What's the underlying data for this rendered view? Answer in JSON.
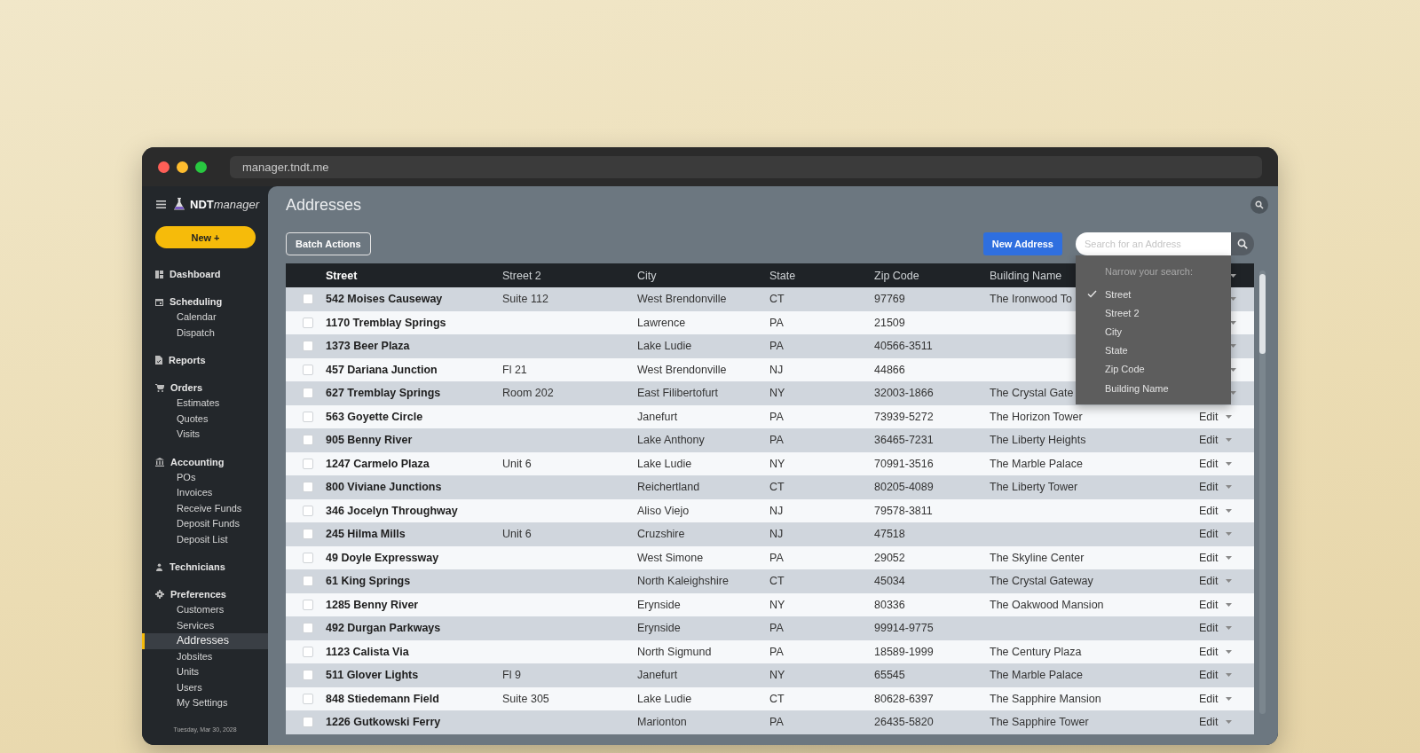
{
  "browser": {
    "url": "manager.tndt.me"
  },
  "sidebar": {
    "logo": {
      "bold": "NDT",
      "italic": "manager"
    },
    "new_button": "New +",
    "sections": [
      {
        "label": "Dashboard",
        "selected": false
      },
      {
        "label": "Scheduling",
        "selected": false,
        "children": [
          {
            "label": "Calendar",
            "selected": false
          },
          {
            "label": "Dispatch",
            "selected": false
          }
        ]
      },
      {
        "label": "Reports",
        "selected": false
      },
      {
        "label": "Orders",
        "selected": false,
        "children": [
          {
            "label": "Estimates",
            "selected": false
          },
          {
            "label": "Quotes",
            "selected": false
          },
          {
            "label": "Visits",
            "selected": false
          }
        ]
      },
      {
        "label": "Accounting",
        "selected": false,
        "children": [
          {
            "label": "POs",
            "selected": false
          },
          {
            "label": "Invoices",
            "selected": false
          },
          {
            "label": "Receive Funds",
            "selected": false
          },
          {
            "label": "Deposit Funds",
            "selected": false
          },
          {
            "label": "Deposit List",
            "selected": false
          }
        ]
      },
      {
        "label": "Technicians",
        "selected": false
      },
      {
        "label": "Preferences",
        "selected": false,
        "children": [
          {
            "label": "Customers",
            "selected": false
          },
          {
            "label": "Services",
            "selected": false
          },
          {
            "label": "Addresses",
            "selected": true
          },
          {
            "label": "Jobsites",
            "selected": false
          },
          {
            "label": "Units",
            "selected": false
          },
          {
            "label": "Users",
            "selected": false
          },
          {
            "label": "My Settings",
            "selected": false
          }
        ]
      }
    ],
    "date": "Tuesday, Mar 30, 2028"
  },
  "page": {
    "title": "Addresses",
    "batch_button": "Batch Actions",
    "new_button": "New Address",
    "search": {
      "placeholder": "Search for an Address"
    }
  },
  "search_menu": {
    "heading": "Narrow your search:",
    "options": [
      {
        "label": "Street",
        "checked": true
      },
      {
        "label": "Street 2",
        "checked": false
      },
      {
        "label": "City",
        "checked": false
      },
      {
        "label": "State",
        "checked": false
      },
      {
        "label": "Zip Code",
        "checked": false
      },
      {
        "label": "Building Name",
        "checked": false
      }
    ]
  },
  "table": {
    "columns": [
      "Street",
      "Street 2",
      "City",
      "State",
      "Zip Code",
      "Building Name"
    ],
    "rows": [
      {
        "checked": false,
        "street": "542 Moises Causeway",
        "street2": "Suite 112",
        "city": "West Brendonville",
        "state": "CT",
        "zip": "97769",
        "building": "The Ironwood To"
      },
      {
        "checked": false,
        "street": "1170 Tremblay Springs",
        "city": "Lawrence",
        "state": "PA",
        "zip": "21509"
      },
      {
        "checked": false,
        "street": "1373 Beer Plaza",
        "city": "Lake Ludie",
        "state": "PA",
        "zip": "40566-3511"
      },
      {
        "checked": false,
        "street": "457 Dariana Junction",
        "street2": "Fl 21",
        "city": "West Brendonville",
        "state": "NJ",
        "zip": "44866"
      },
      {
        "checked": false,
        "street": "627 Tremblay Springs",
        "street2": "Room 202",
        "city": "East Filibertofurt",
        "state": "NY",
        "zip": "32003-1866",
        "building": "The Crystal Gate"
      },
      {
        "checked": false,
        "street": "563 Goyette Circle",
        "city": "Janefurt",
        "state": "PA",
        "zip": "73939-5272",
        "building": "The Horizon Tower",
        "action": "Edit"
      },
      {
        "checked": false,
        "street": "905 Benny River",
        "city": "Lake Anthony",
        "state": "PA",
        "zip": "36465-7231",
        "building": "The Liberty Heights",
        "action": "Edit"
      },
      {
        "checked": false,
        "street": "1247 Carmelo Plaza",
        "street2": "Unit 6",
        "city": "Lake Ludie",
        "state": "NY",
        "zip": "70991-3516",
        "building": "The Marble Palace",
        "action": "Edit"
      },
      {
        "checked": false,
        "street": "800 Viviane Junctions",
        "city": "Reichertland",
        "state": "CT",
        "zip": "80205-4089",
        "building": "The Liberty Tower",
        "action": "Edit"
      },
      {
        "checked": false,
        "street": "346 Jocelyn Throughway",
        "city": "Aliso Viejo",
        "state": "NJ",
        "zip": "79578-3811",
        "action": "Edit"
      },
      {
        "checked": false,
        "street": "245 Hilma Mills",
        "street2": "Unit 6",
        "city": "Cruzshire",
        "state": "NJ",
        "zip": "47518",
        "action": "Edit"
      },
      {
        "checked": false,
        "street": "49 Doyle Expressway",
        "city": "West Simone",
        "state": "PA",
        "zip": "29052",
        "building": "The Skyline Center",
        "action": "Edit"
      },
      {
        "checked": false,
        "street": "61 King Springs",
        "city": "North Kaleighshire",
        "state": "CT",
        "zip": "45034",
        "building": "The Crystal Gateway",
        "action": "Edit"
      },
      {
        "checked": false,
        "street": "1285 Benny River",
        "city": "Erynside",
        "state": "NY",
        "zip": "80336",
        "building": "The Oakwood Mansion",
        "action": "Edit"
      },
      {
        "checked": false,
        "street": "492 Durgan Parkways",
        "city": "Erynside",
        "state": "PA",
        "zip": "99914-9775",
        "action": "Edit"
      },
      {
        "checked": false,
        "street": "1123 Calista Via",
        "city": "North Sigmund",
        "state": "PA",
        "zip": "18589-1999",
        "building": "The Century Plaza",
        "action": "Edit"
      },
      {
        "checked": false,
        "street": "511 Glover Lights",
        "street2": "Fl 9",
        "city": "Janefurt",
        "state": "NY",
        "zip": "65545",
        "building": "The Marble Palace",
        "action": "Edit"
      },
      {
        "checked": false,
        "street": "848 Stiedemann Field",
        "street2": "Suite 305",
        "city": "Lake Ludie",
        "state": "CT",
        "zip": "80628-6397",
        "building": "The Sapphire Mansion",
        "action": "Edit"
      },
      {
        "checked": false,
        "street": "1226 Gutkowski Ferry",
        "city": "Marionton",
        "state": "PA",
        "zip": "26435-5820",
        "building": "The Sapphire Tower",
        "action": "Edit"
      }
    ]
  }
}
